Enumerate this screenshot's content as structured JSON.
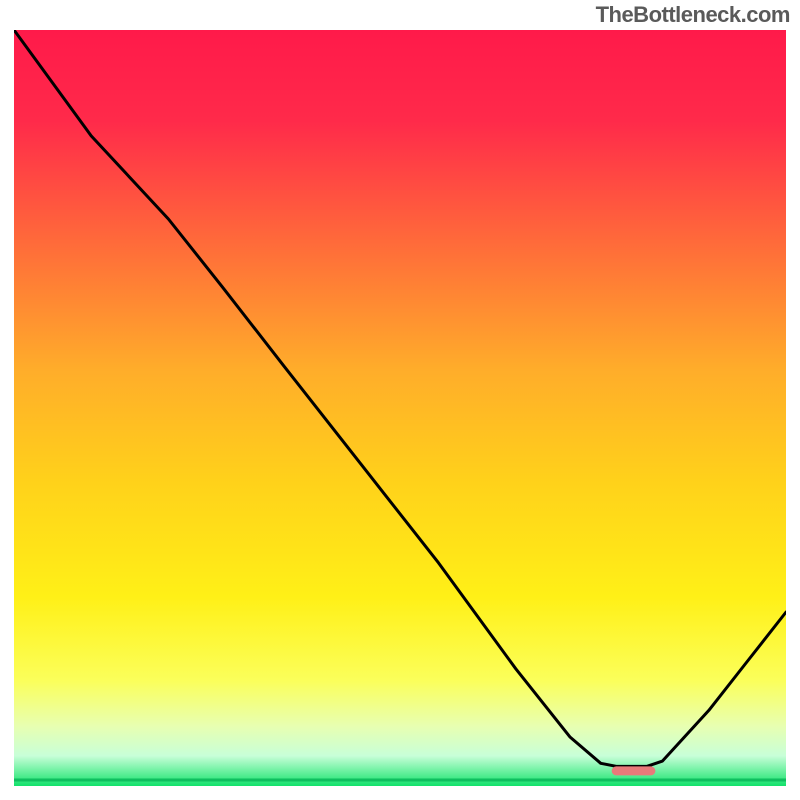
{
  "watermark": "TheBottleneck.com",
  "chart_data": {
    "type": "line",
    "title": "",
    "xlabel": "",
    "ylabel": "",
    "xlim": [
      0,
      100
    ],
    "ylim": [
      0,
      100
    ],
    "gradient_stops": [
      {
        "offset": 0.0,
        "color": "#ff1a4a"
      },
      {
        "offset": 0.12,
        "color": "#ff2a4a"
      },
      {
        "offset": 0.28,
        "color": "#ff6a3a"
      },
      {
        "offset": 0.45,
        "color": "#ffad2a"
      },
      {
        "offset": 0.6,
        "color": "#ffd21a"
      },
      {
        "offset": 0.75,
        "color": "#fff017"
      },
      {
        "offset": 0.86,
        "color": "#fbff5a"
      },
      {
        "offset": 0.92,
        "color": "#e8ffb0"
      },
      {
        "offset": 0.96,
        "color": "#c8ffd8"
      },
      {
        "offset": 1.0,
        "color": "#13e26b"
      }
    ],
    "curve_points": [
      {
        "x": 0.0,
        "y": 100.0
      },
      {
        "x": 10.0,
        "y": 86.0
      },
      {
        "x": 20.0,
        "y": 75.0
      },
      {
        "x": 27.0,
        "y": 66.0
      },
      {
        "x": 35.0,
        "y": 55.5
      },
      {
        "x": 45.0,
        "y": 42.5
      },
      {
        "x": 55.0,
        "y": 29.5
      },
      {
        "x": 65.0,
        "y": 15.5
      },
      {
        "x": 72.0,
        "y": 6.5
      },
      {
        "x": 76.0,
        "y": 3.0
      },
      {
        "x": 78.0,
        "y": 2.6
      },
      {
        "x": 82.0,
        "y": 2.6
      },
      {
        "x": 84.0,
        "y": 3.3
      },
      {
        "x": 90.0,
        "y": 10.0
      },
      {
        "x": 95.0,
        "y": 16.5
      },
      {
        "x": 100.0,
        "y": 23.0
      }
    ],
    "baseline_marker": {
      "x_start": 78.0,
      "x_end": 82.5,
      "y": 2.0,
      "color": "#e87a7a",
      "thickness": 9
    },
    "baseline_green": {
      "x_start": 0.0,
      "x_end": 100.0,
      "y": 0.8,
      "color": "#0fbf5f",
      "thickness": 3
    }
  }
}
